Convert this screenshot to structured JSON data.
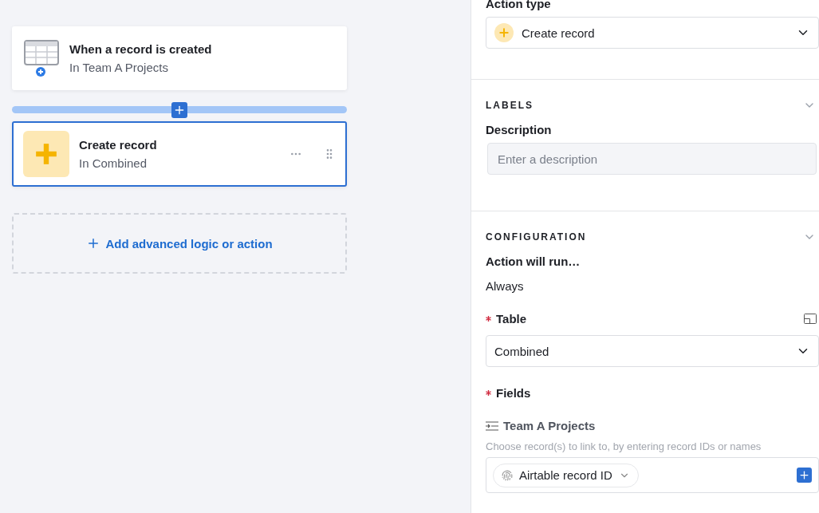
{
  "canvas": {
    "trigger": {
      "title": "When a record is created",
      "subtitle": "In Team A Projects"
    },
    "actions": [
      {
        "title": "Create record",
        "subtitle": "In Combined",
        "selected": true
      }
    ],
    "add_action": {
      "label": "Add advanced logic or action"
    }
  },
  "panel": {
    "action_type": {
      "label": "Action type",
      "value": "Create record"
    },
    "labels": {
      "heading": "LABELS",
      "expanded": true,
      "description_label": "Description",
      "description_placeholder": "Enter a description"
    },
    "configuration": {
      "heading": "CONFIGURATION",
      "expanded": true,
      "run_label": "Action will run…",
      "run_value": "Always",
      "table": {
        "label": "Table",
        "required": true,
        "value": "Combined"
      },
      "fields": {
        "label": "Fields",
        "required": true,
        "items": [
          {
            "name": "Team A Projects",
            "hint": "Choose record(s) to link to, by entering record IDs or names",
            "token": "Airtable record ID"
          }
        ]
      }
    }
  }
}
